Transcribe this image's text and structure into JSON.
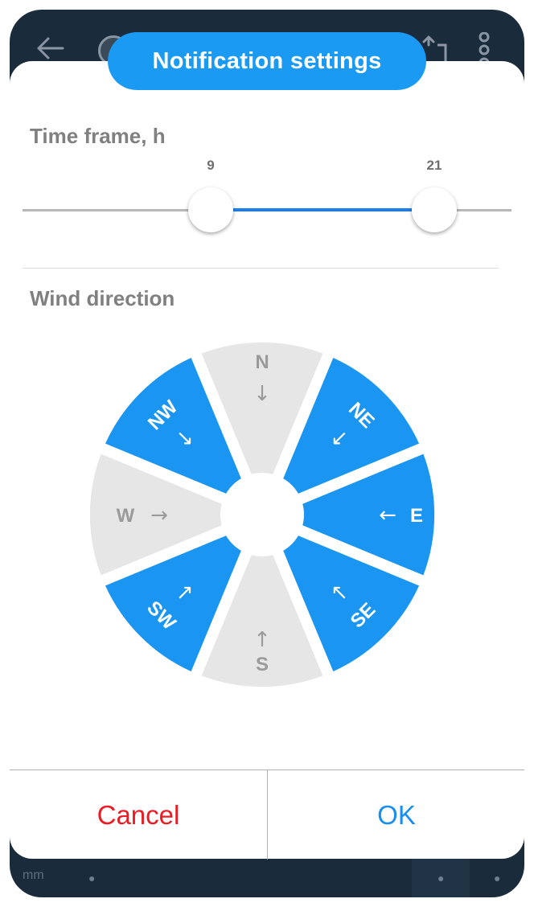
{
  "dialog": {
    "title": "Notification settings",
    "time_frame_label": "Time frame, h",
    "time_frame": {
      "min_value": "9",
      "max_value": "21",
      "range_start": 0,
      "range_end": 24
    },
    "wind_direction_label": "Wind direction",
    "directions": [
      {
        "id": "n",
        "label": "N",
        "arrow": "↓",
        "selected": false
      },
      {
        "id": "ne",
        "label": "NE",
        "arrow": "↙",
        "selected": true
      },
      {
        "id": "e",
        "label": "E",
        "arrow": "←",
        "selected": true
      },
      {
        "id": "se",
        "label": "SE",
        "arrow": "↖",
        "selected": true
      },
      {
        "id": "s",
        "label": "S",
        "arrow": "↑",
        "selected": false
      },
      {
        "id": "sw",
        "label": "SW",
        "arrow": "↗",
        "selected": true
      },
      {
        "id": "w",
        "label": "W",
        "arrow": "→",
        "selected": false
      },
      {
        "id": "nw",
        "label": "NW",
        "arrow": "↘",
        "selected": true
      }
    ],
    "cancel_label": "Cancel",
    "ok_label": "OK"
  },
  "background": {
    "bottom_unit": "mm"
  },
  "colors": {
    "accent": "#1a9af2",
    "selected_sector": "#1a96f2",
    "unselected_sector": "#e6e6e6",
    "cancel": "#ec1c24",
    "ok": "#1a8ef0",
    "backdrop": "#1a2b3c"
  }
}
